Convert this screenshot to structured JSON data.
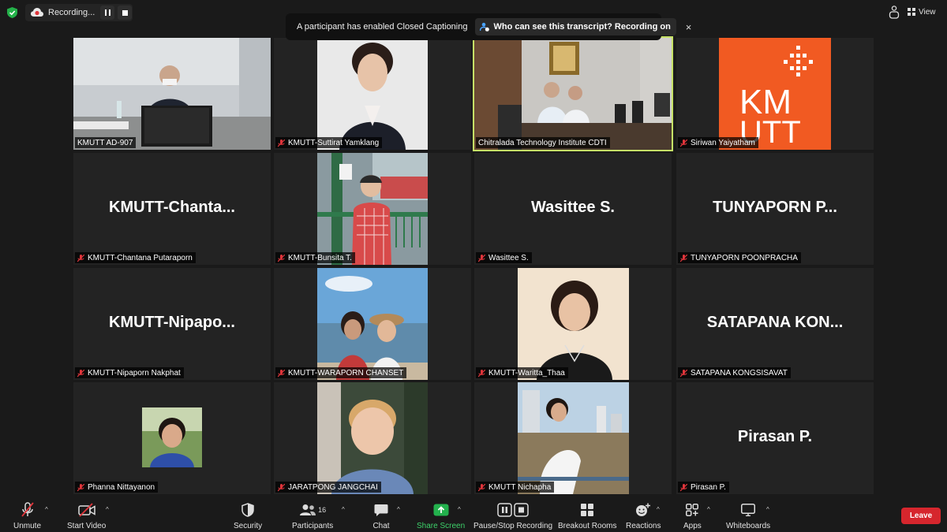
{
  "recording": {
    "label": "Recording..."
  },
  "cc_banner": {
    "message": "A participant has enabled Closed Captioning",
    "who_label": "Who can see this transcript? Recording on",
    "close_glyph": "×"
  },
  "view": {
    "label": "View"
  },
  "tiles": [
    {
      "caption": "KMUTT AD-907",
      "muted": false,
      "big_name": ""
    },
    {
      "caption": "KMUTT-Suttirat Yamklang",
      "muted": true,
      "big_name": ""
    },
    {
      "caption": "Chitralada Technology Institute CDTI",
      "muted": false,
      "big_name": "",
      "active_speaker": true
    },
    {
      "caption": "Siriwan Yaiyatham",
      "muted": true,
      "big_name": "",
      "logo_text_top": "KM",
      "logo_text_bottom": "UTT"
    },
    {
      "caption": "KMUTT-Chantana Putaraporn",
      "muted": true,
      "big_name": "KMUTT-Chanta..."
    },
    {
      "caption": "KMUTT-Bunsita T.",
      "muted": true,
      "big_name": ""
    },
    {
      "caption": "Wasittee S.",
      "muted": true,
      "big_name": "Wasittee S."
    },
    {
      "caption": "TUNYAPORN POONPRACHA",
      "muted": true,
      "big_name": "TUNYAPORN  P..."
    },
    {
      "caption": "KMUTT-Nipaporn Nakphat",
      "muted": true,
      "big_name": "KMUTT-Nipapo..."
    },
    {
      "caption": "KMUTT-WARAPORN CHANSET",
      "muted": true,
      "big_name": ""
    },
    {
      "caption": "KMUTT-Waritta_Thaa",
      "muted": true,
      "big_name": ""
    },
    {
      "caption": "SATAPANA KONGSISAVAT",
      "muted": true,
      "big_name": "SATAPANA  KON..."
    },
    {
      "caption": "Phanna Nittayanon",
      "muted": true,
      "big_name": ""
    },
    {
      "caption": "JARATPONG JANGCHAI",
      "muted": true,
      "big_name": ""
    },
    {
      "caption": "KMUTT Nichapha",
      "muted": true,
      "big_name": ""
    },
    {
      "caption": "Pirasan P.",
      "muted": true,
      "big_name": "Pirasan P."
    }
  ],
  "toolbar": {
    "unmute": "Unmute",
    "start_video": "Start Video",
    "security": "Security",
    "participants": "Participants",
    "participants_count": "16",
    "chat": "Chat",
    "share_screen": "Share Screen",
    "pause_stop_recording": "Pause/Stop Recording",
    "breakout_rooms": "Breakout Rooms",
    "reactions": "Reactions",
    "apps": "Apps",
    "whiteboards": "Whiteboards",
    "leave": "Leave",
    "caret": "^"
  },
  "colors": {
    "active_speaker_border": "#c6e267",
    "leave_red": "#d6262d",
    "share_green": "#3dd16a",
    "muted_red": "#e0353b",
    "kmutt_orange": "#f15a22"
  }
}
